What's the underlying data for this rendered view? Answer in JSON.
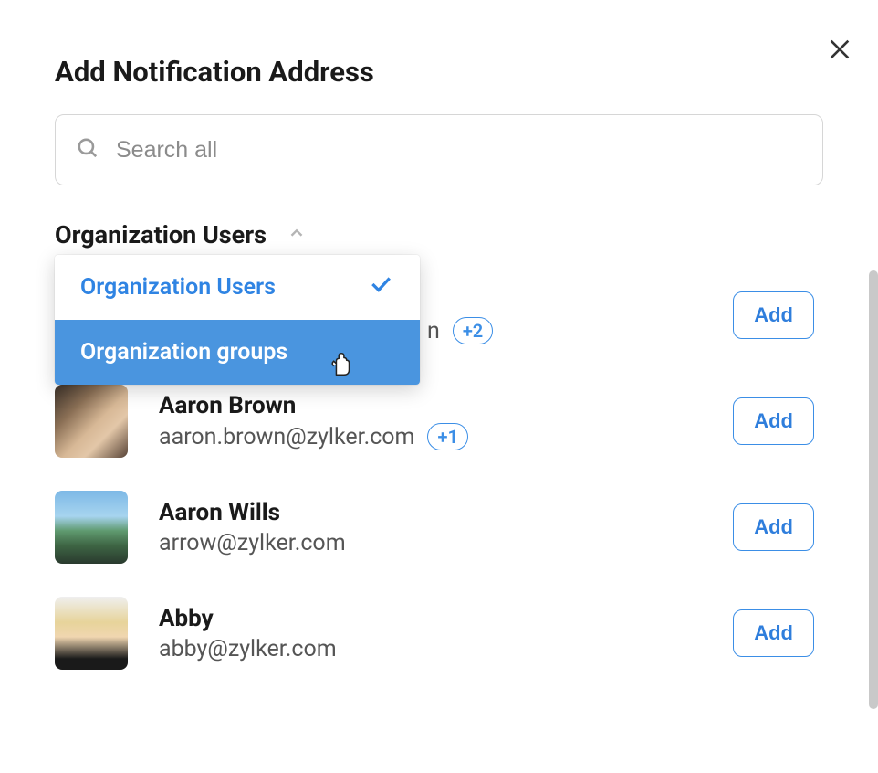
{
  "modal": {
    "title": "Add Notification Address"
  },
  "search": {
    "placeholder": "Search all"
  },
  "filter": {
    "selected_label": "Organization Users",
    "options": [
      {
        "label": "Organization Users",
        "selected": true
      },
      {
        "label": "Organization groups",
        "selected": false
      }
    ]
  },
  "users": [
    {
      "name": "",
      "email_fragment": "n",
      "extra_badge": "+2",
      "add_label": "Add"
    },
    {
      "name": "Aaron Brown",
      "email": "aaron.brown@zylker.com",
      "extra_badge": "+1",
      "add_label": "Add"
    },
    {
      "name": "Aaron Wills",
      "email": "arrow@zylker.com",
      "extra_badge": null,
      "add_label": "Add"
    },
    {
      "name": "Abby",
      "email": "abby@zylker.com",
      "extra_badge": null,
      "add_label": "Add"
    }
  ]
}
